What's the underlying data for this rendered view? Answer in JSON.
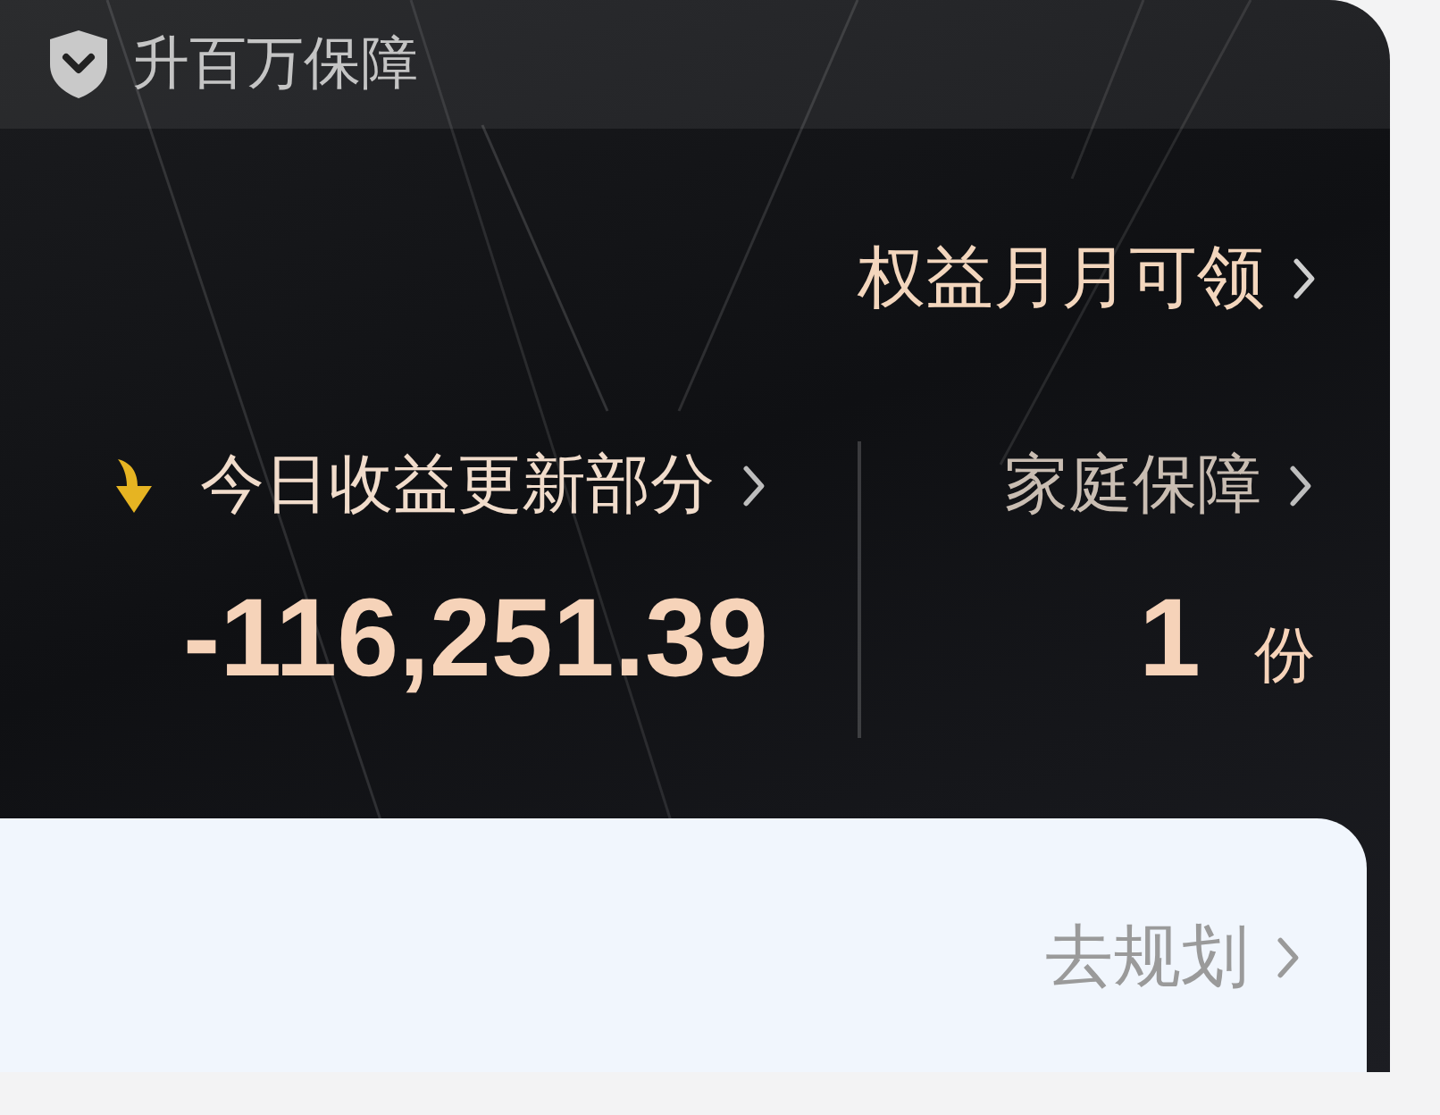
{
  "header": {
    "title": "升百万保障"
  },
  "benefit_link": "权益月月可领",
  "stats": [
    {
      "label": "今日收益更新部分",
      "value": "-116,251.39",
      "kind": "decrease"
    },
    {
      "label": "家庭保障",
      "value": "1",
      "unit": "份",
      "kind": "count"
    }
  ],
  "plan_card": {
    "link": "去规划"
  }
}
